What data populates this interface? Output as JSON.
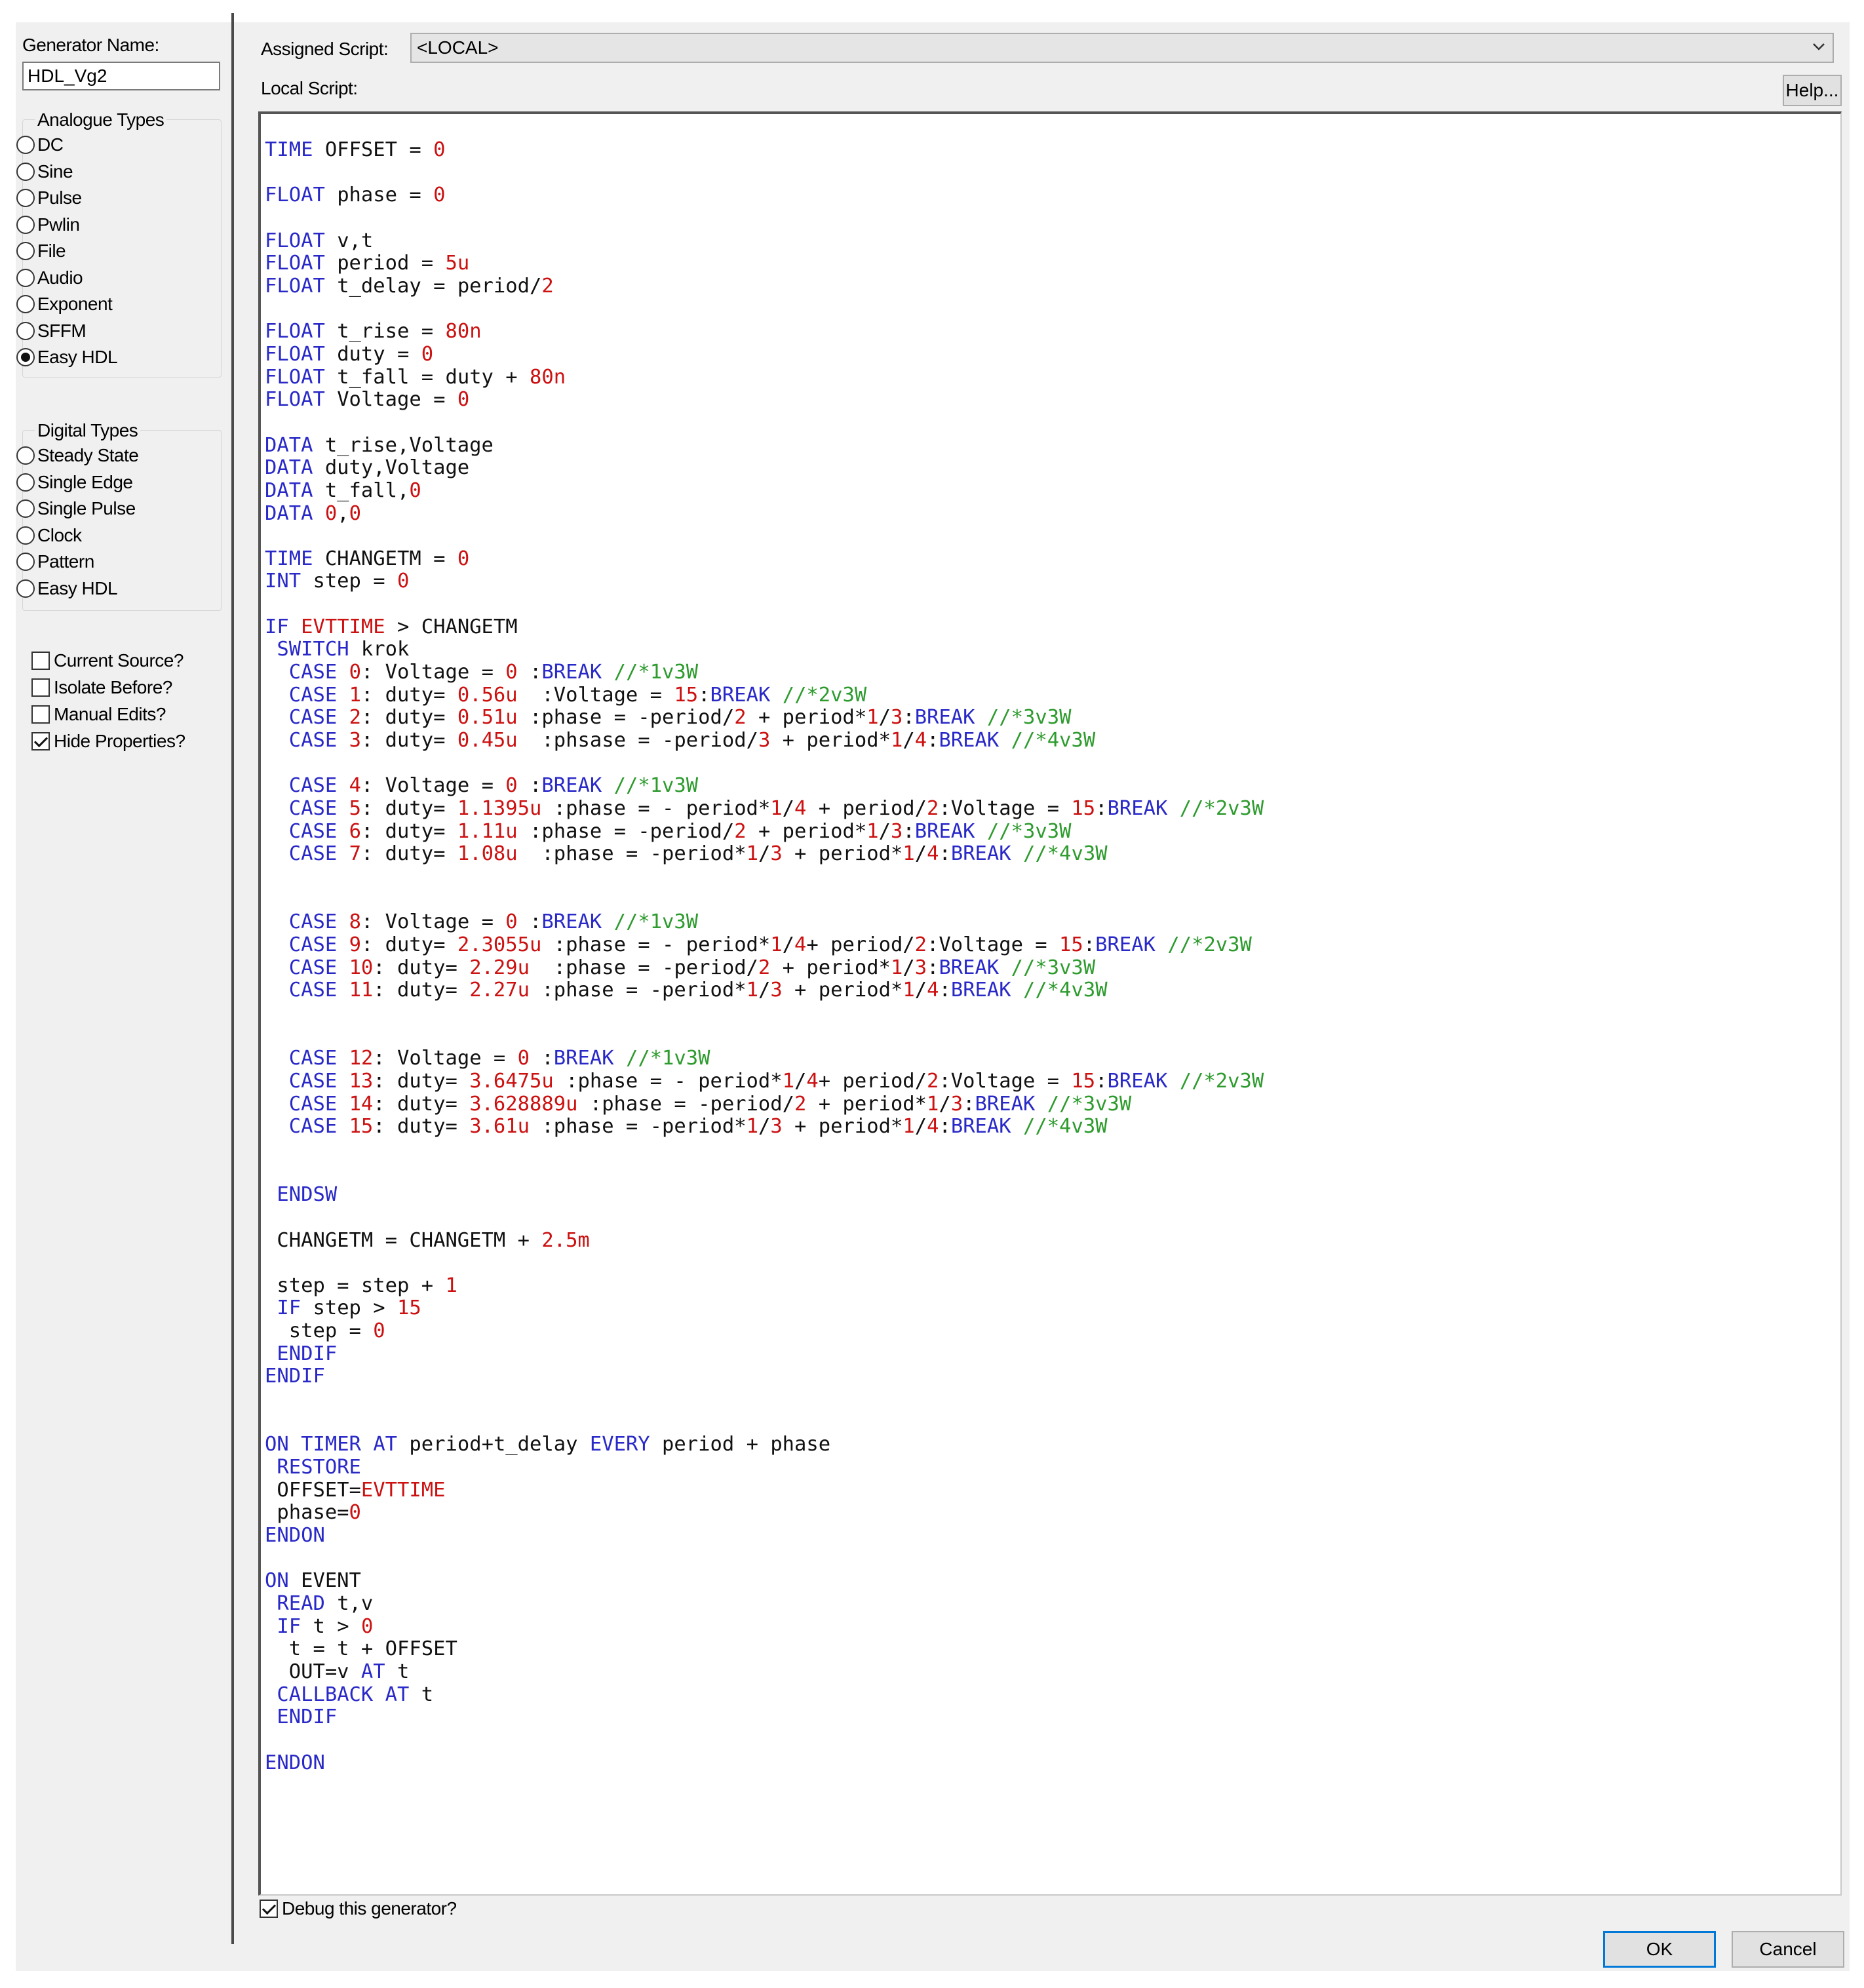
{
  "left": {
    "generator_name_label": "Generator Name:",
    "generator_name_value": "HDL_Vg2",
    "analogue_title": "Analogue Types",
    "analogue": [
      {
        "label": "DC",
        "selected": false
      },
      {
        "label": "Sine",
        "selected": false
      },
      {
        "label": "Pulse",
        "selected": false
      },
      {
        "label": "Pwlin",
        "selected": false
      },
      {
        "label": "File",
        "selected": false
      },
      {
        "label": "Audio",
        "selected": false
      },
      {
        "label": "Exponent",
        "selected": false
      },
      {
        "label": "SFFM",
        "selected": false
      },
      {
        "label": "Easy HDL",
        "selected": true
      }
    ],
    "digital_title": "Digital Types",
    "digital": [
      {
        "label": "Steady State",
        "selected": false
      },
      {
        "label": "Single Edge",
        "selected": false
      },
      {
        "label": "Single Pulse",
        "selected": false
      },
      {
        "label": "Clock",
        "selected": false
      },
      {
        "label": "Pattern",
        "selected": false
      },
      {
        "label": "Easy HDL",
        "selected": false
      }
    ],
    "options": [
      {
        "label": "Current Source?",
        "checked": false
      },
      {
        "label": "Isolate Before?",
        "checked": false
      },
      {
        "label": "Manual Edits?",
        "checked": false
      },
      {
        "label": "Hide Properties?",
        "checked": true
      }
    ]
  },
  "right": {
    "assigned_script_label": "Assigned Script:",
    "assigned_script_value": "<LOCAL>",
    "local_script_label": "Local Script:",
    "help_button": "Help...",
    "debug_label": "Debug this generator?",
    "debug_checked": true,
    "ok_button": "OK",
    "cancel_button": "Cancel"
  },
  "script": [
    "TIME OFFSET = 0",
    "",
    "FLOAT phase = 0",
    "",
    "FLOAT v,t",
    "FLOAT period = 5u",
    "FLOAT t_delay = period/2",
    "",
    "FLOAT t_rise = 80n",
    "FLOAT duty = 0",
    "FLOAT t_fall = duty + 80n",
    "FLOAT Voltage = 0",
    "",
    "DATA t_rise,Voltage",
    "DATA duty,Voltage",
    "DATA t_fall,0",
    "DATA 0,0",
    "",
    "TIME CHANGETM = 0",
    "INT step = 0",
    "",
    "IF EVTTIME > CHANGETM",
    " SWITCH krok",
    "  CASE 0: Voltage = 0 :BREAK //*1v3W",
    "  CASE 1: duty= 0.56u  :Voltage = 15:BREAK //*2v3W",
    "  CASE 2: duty= 0.51u :phase = -period/2 + period*1/3:BREAK //*3v3W",
    "  CASE 3: duty= 0.45u  :phsase = -period/3 + period*1/4:BREAK //*4v3W",
    "",
    "  CASE 4: Voltage = 0 :BREAK //*1v3W",
    "  CASE 5: duty= 1.1395u :phase = - period*1/4 + period/2:Voltage = 15:BREAK //*2v3W",
    "  CASE 6: duty= 1.11u :phase = -period/2 + period*1/3:BREAK //*3v3W",
    "  CASE 7: duty= 1.08u  :phase = -period*1/3 + period*1/4:BREAK //*4v3W",
    "",
    "",
    "  CASE 8: Voltage = 0 :BREAK //*1v3W",
    "  CASE 9: duty= 2.3055u :phase = - period*1/4+ period/2:Voltage = 15:BREAK //*2v3W",
    "  CASE 10: duty= 2.29u  :phase = -period/2 + period*1/3:BREAK //*3v3W",
    "  CASE 11: duty= 2.27u :phase = -period*1/3 + period*1/4:BREAK //*4v3W",
    "",
    "",
    "  CASE 12: Voltage = 0 :BREAK //*1v3W",
    "  CASE 13: duty= 3.6475u :phase = - period*1/4+ period/2:Voltage = 15:BREAK //*2v3W",
    "  CASE 14: duty= 3.628889u :phase = -period/2 + period*1/3:BREAK //*3v3W",
    "  CASE 15: duty= 3.61u :phase = -period*1/3 + period*1/4:BREAK //*4v3W",
    "",
    "",
    " ENDSW",
    "",
    " CHANGETM = CHANGETM + 2.5m",
    "",
    " step = step + 1",
    " IF step > 15",
    "  step = 0",
    " ENDIF",
    "ENDIF",
    "",
    "",
    "ON TIMER AT period+t_delay EVERY period + phase",
    " RESTORE",
    " OFFSET=EVTTIME",
    " phase=0",
    "ENDON",
    "",
    "ON EVENT",
    " READ t,v",
    " IF t > 0",
    "  t = t + OFFSET",
    "  OUT=v AT t",
    " CALLBACK AT t",
    " ENDIF",
    "",
    "ENDON"
  ],
  "syntax_colors": {
    "keyword": "#2929c8",
    "number": "#cc1111",
    "comment": "#2e9b2e",
    "text": "#111111"
  }
}
